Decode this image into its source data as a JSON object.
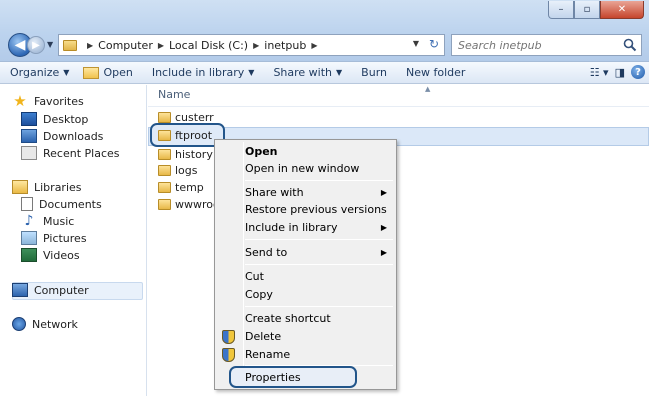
{
  "window": {
    "caption_buttons": {
      "minimize": "–",
      "maximize": "▫",
      "close": "✕"
    }
  },
  "address": {
    "breadcrumbs": [
      "Computer",
      "Local Disk (C:)",
      "inetpub"
    ],
    "search_placeholder": "Search inetpub"
  },
  "commandbar": {
    "organize": "Organize",
    "open": "Open",
    "include_in_library": "Include in library",
    "share_with": "Share with",
    "burn": "Burn",
    "new_folder": "New folder"
  },
  "navpane": {
    "favorites": "Favorites",
    "desktop": "Desktop",
    "downloads": "Downloads",
    "recent_places": "Recent Places",
    "libraries": "Libraries",
    "documents": "Documents",
    "music": "Music",
    "pictures": "Pictures",
    "videos": "Videos",
    "computer": "Computer",
    "network": "Network"
  },
  "filelist": {
    "column_name": "Name",
    "files": [
      "custerr",
      "ftproot",
      "history",
      "logs",
      "temp",
      "wwwroot"
    ]
  },
  "context_menu": {
    "open": "Open",
    "open_new_window": "Open in new window",
    "share_with": "Share with",
    "restore_previous": "Restore previous versions",
    "include_in_library": "Include in library",
    "send_to": "Send to",
    "cut": "Cut",
    "copy": "Copy",
    "create_shortcut": "Create shortcut",
    "delete": "Delete",
    "rename": "Rename",
    "properties": "Properties"
  },
  "colors": {
    "highlight_ring": "#22558a",
    "selection": "#dbe8f8"
  }
}
